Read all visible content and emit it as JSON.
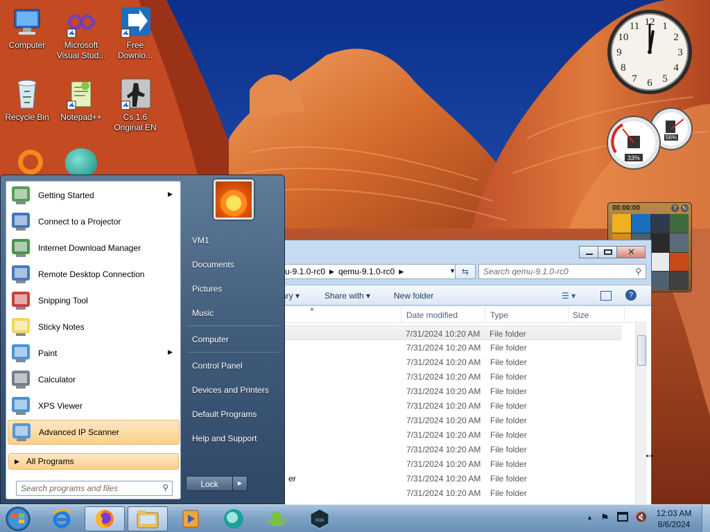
{
  "desktop": {
    "icons": [
      {
        "label": "Computer"
      },
      {
        "label": "Microsoft Visual Stud..."
      },
      {
        "label": "Free Downlo..."
      },
      {
        "label": "Recycle Bin"
      },
      {
        "label": "Notepad++"
      },
      {
        "label": "Cs 1.6 Original EN"
      }
    ],
    "clock_gadget": {
      "numerals": [
        "12",
        "1",
        "2",
        "3",
        "4",
        "5",
        "6",
        "7",
        "8",
        "9",
        "10",
        "11"
      ]
    },
    "meter_gadget": {
      "cpu_label": "33%",
      "cpu_value": 0.33,
      "mem_label": "56%",
      "mem_value": 0.56
    },
    "puzzle_gadget": {
      "timer": "00:00:00"
    }
  },
  "explorer": {
    "address": {
      "crumb1": "u-9.1.0-rc0",
      "crumb2": "qemu-9.1.0-rc0"
    },
    "search_placeholder": "Search qemu-9.1.0-rc0",
    "toolbar": {
      "library": "ary",
      "share_with": "Share with",
      "new_folder": "New folder"
    },
    "columns": {
      "date": "Date modified",
      "type": "Type",
      "size": "Size"
    },
    "rows": [
      {
        "name": "",
        "date": "7/31/2024 10:20 AM",
        "type": "File folder"
      },
      {
        "name": "",
        "date": "7/31/2024 10:20 AM",
        "type": "File folder"
      },
      {
        "name": "",
        "date": "7/31/2024 10:20 AM",
        "type": "File folder"
      },
      {
        "name": "",
        "date": "7/31/2024 10:20 AM",
        "type": "File folder"
      },
      {
        "name": "",
        "date": "7/31/2024 10:20 AM",
        "type": "File folder"
      },
      {
        "name": "",
        "date": "7/31/2024 10:20 AM",
        "type": "File folder"
      },
      {
        "name": "",
        "date": "7/31/2024 10:20 AM",
        "type": "File folder"
      },
      {
        "name": "",
        "date": "7/31/2024 10:20 AM",
        "type": "File folder"
      },
      {
        "name": "",
        "date": "7/31/2024 10:20 AM",
        "type": "File folder"
      },
      {
        "name": "",
        "date": "7/31/2024 10:20 AM",
        "type": "File folder"
      },
      {
        "name": "er",
        "date": "7/31/2024 10:20 AM",
        "type": "File folder"
      },
      {
        "name": "",
        "date": "7/31/2024 10:20 AM",
        "type": "File folder"
      }
    ]
  },
  "start_menu": {
    "programs": [
      {
        "label": "Getting Started",
        "icon": "getting-started-icon"
      },
      {
        "label": "Connect to a Projector",
        "icon": "projector-icon"
      },
      {
        "label": "Internet Download Manager",
        "icon": "idm-icon"
      },
      {
        "label": "Remote Desktop Connection",
        "icon": "remote-desktop-icon"
      },
      {
        "label": "Snipping Tool",
        "icon": "scissors-icon"
      },
      {
        "label": "Sticky Notes",
        "icon": "sticky-notes-icon"
      },
      {
        "label": "Paint",
        "icon": "paint-icon"
      },
      {
        "label": "Calculator",
        "icon": "calculator-icon"
      },
      {
        "label": "XPS Viewer",
        "icon": "xps-icon"
      },
      {
        "label": "Advanced IP Scanner",
        "icon": "ip-scanner-icon"
      }
    ],
    "all_programs": "All Programs",
    "search_placeholder": "Search programs and files",
    "right": {
      "user": "VM1",
      "documents": "Documents",
      "pictures": "Pictures",
      "music": "Music",
      "computer": "Computer",
      "control_panel": "Control Panel",
      "devices": "Devices and Printers",
      "default_programs": "Default Programs",
      "help": "Help and Support"
    },
    "lock": "Lock"
  },
  "taskbar": {
    "time": "12:03 AM",
    "date": "8/6/2024"
  }
}
